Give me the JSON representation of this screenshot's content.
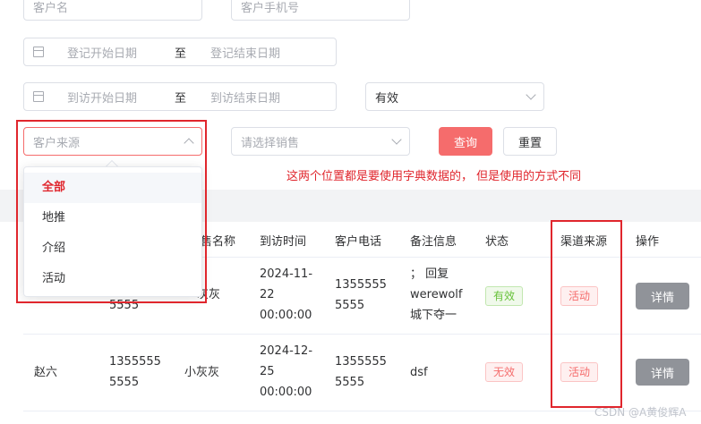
{
  "filters": {
    "customer_name_placeholder": "客户名",
    "customer_phone_placeholder": "客户手机号",
    "register_start_placeholder": "登记开始日期",
    "register_end_placeholder": "登记结束日期",
    "range_separator": "至",
    "visit_start_placeholder": "到访开始日期",
    "visit_end_placeholder": "到访结束日期",
    "status_value": "有效",
    "source_placeholder": "客户来源",
    "sales_placeholder": "请选择销售",
    "query_label": "查询",
    "reset_label": "重置"
  },
  "annotation": "这两个位置都是要使用字典数据的， 但是使用的方式不同",
  "dropdown": {
    "items": [
      "全部",
      "地推",
      "介绍",
      "活动"
    ]
  },
  "table": {
    "headers": {
      "sales_name_partial": "售名称",
      "visit_time": "到访时间",
      "customer_phone": "客户电话",
      "remark": "备注信息",
      "status": "状态",
      "channel": "渠道来源",
      "action": "操作"
    },
    "rows": [
      {
        "phone_partial": "5555",
        "sales_partial": "灰灰",
        "visit_time_line1": "2024-11-",
        "visit_time_line2": "22",
        "visit_time_line3": "00:00:00",
        "customer_phone_line1": "1355555",
        "customer_phone_line2": "5555",
        "remark_line1": "； 回复",
        "remark_line2": "werewolf",
        "remark_line3": "城下夺一",
        "status": "有效",
        "channel": "活动",
        "detail": "详情"
      },
      {
        "name": "赵六",
        "phone_line1": "1355555",
        "phone_line2": "5555",
        "sales": "小灰灰",
        "visit_time_line1": "2024-12-",
        "visit_time_line2": "25",
        "visit_time_line3": "00:00:00",
        "customer_phone_line1": "1355555",
        "customer_phone_line2": "5555",
        "remark": "dsf",
        "status": "无效",
        "channel": "活动",
        "detail": "详情"
      }
    ]
  },
  "watermark": "CSDN @A黄俊辉A",
  "colors": {
    "annotation_red": "#e0262d",
    "primary_button": "#f56c6c",
    "valid_tag": "#67c23a",
    "invalid_tag": "#f56c6c",
    "detail_button": "#909399"
  }
}
